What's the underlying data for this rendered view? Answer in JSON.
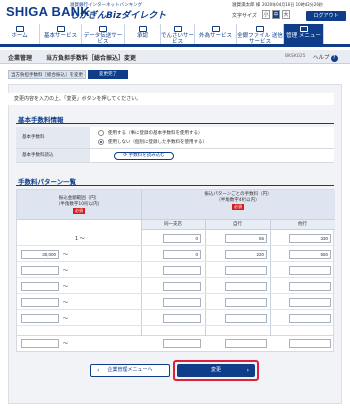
{
  "header": {
    "logo": "SHIGA BANK",
    "tagline": "滋賀銀行インターネットバンキング",
    "brand": "しがぎんBizダイレクト",
    "user": "滋賀満太郎 様",
    "last_login": "2020年04月16日 10時42分26秒",
    "font_size_label": "文字サイズ",
    "font_sizes": [
      "小",
      "中",
      "大"
    ],
    "logout": "ログアウト"
  },
  "nav": [
    {
      "label": "ホーム",
      "icon": "home-icon"
    },
    {
      "label": "基本サービス",
      "icon": "service-icon"
    },
    {
      "label": "データ伝送サービス",
      "icon": "data-icon"
    },
    {
      "label": "承認",
      "icon": "approve-icon"
    },
    {
      "label": "でんさいサービス",
      "icon": "densai-icon"
    },
    {
      "label": "外為サービス",
      "icon": "forex-icon"
    },
    {
      "label": "全銀ファイル\n送信サービス",
      "icon": "file-icon"
    },
    {
      "label": "管理\nメニュー",
      "icon": "menu-icon"
    }
  ],
  "page": {
    "section": "企業管理",
    "title": "当方負担手数料［総合振込］変更",
    "code": "BKSK025",
    "help": "ヘルプ"
  },
  "steps": [
    "当方負担手数料［総合振込］を変更",
    "変更完了"
  ],
  "message": "変更内容を入力の上、「変更」ボタンを押してください。",
  "basic": {
    "heading": "基本手数料情報",
    "fee_label": "基本手数料",
    "option1": "使用する（事に登録の基本手数料を使用する）",
    "option2": "使用しない（個別に登録した手数料を使用する）",
    "load_label": "基本手数料読込",
    "load_button": "手数料を読み込む"
  },
  "pattern": {
    "heading": "手数料パターン一覧",
    "col_amount": "振込金額範囲（円）",
    "col_amount_note": "（半角数字10桁以内）",
    "col_fee": "振込パターンごとの手数料（円）",
    "col_fee_note": "（半角数字4桁以内）",
    "required": "必須",
    "sub_cols": [
      "同一支店",
      "自行",
      "他行"
    ],
    "rows": [
      {
        "from": "",
        "to": "",
        "same": "0",
        "own": "55",
        "other": "330"
      },
      {
        "from": "30,000",
        "to": "",
        "same": "0",
        "own": "220",
        "other": "550"
      },
      {
        "from": "",
        "to": "",
        "same": "",
        "own": "",
        "other": ""
      },
      {
        "from": "",
        "to": "",
        "same": "",
        "own": "",
        "other": ""
      },
      {
        "from": "",
        "to": "",
        "same": "",
        "own": "",
        "other": ""
      },
      {
        "from": "",
        "to": "",
        "same": "",
        "own": "",
        "other": ""
      },
      {
        "from": "",
        "to": "",
        "same": "",
        "own": "",
        "other": ""
      }
    ]
  },
  "buttons": {
    "back": "企業管理メニューへ",
    "submit": "変更"
  },
  "colors": {
    "brand_blue": "#0f3d8a",
    "highlight_red": "#e0203a",
    "required_red": "#d51d1d"
  }
}
